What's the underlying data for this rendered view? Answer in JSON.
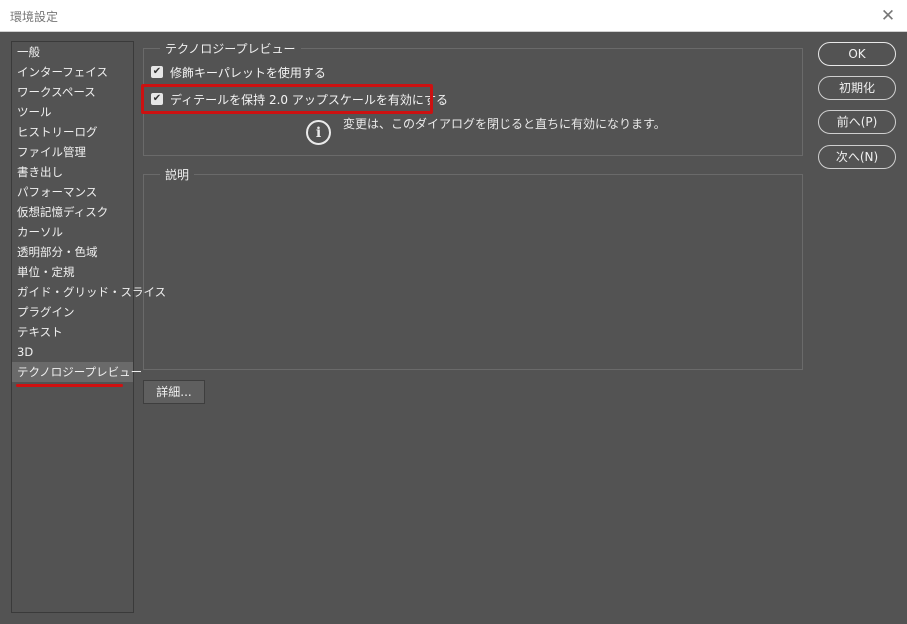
{
  "window": {
    "title": "環境設定",
    "close_glyph": "✕"
  },
  "sidebar": {
    "items": [
      {
        "label": "一般"
      },
      {
        "label": "インターフェイス"
      },
      {
        "label": "ワークスペース"
      },
      {
        "label": "ツール"
      },
      {
        "label": "ヒストリーログ"
      },
      {
        "label": "ファイル管理"
      },
      {
        "label": "書き出し"
      },
      {
        "label": "パフォーマンス"
      },
      {
        "label": "仮想記憶ディスク"
      },
      {
        "label": "カーソル"
      },
      {
        "label": "透明部分・色域"
      },
      {
        "label": "単位・定規"
      },
      {
        "label": "ガイド・グリッド・スライス"
      },
      {
        "label": "プラグイン"
      },
      {
        "label": "テキスト"
      },
      {
        "label": "3D"
      },
      {
        "label": "テクノロジープレビュー",
        "selected": true
      }
    ]
  },
  "tech_preview": {
    "legend": "テクノロジープレビュー",
    "option1": {
      "label": "修飾キーパレットを使用する",
      "checked": true
    },
    "option2": {
      "label": "ディテールを保持 2.0 アップスケールを有効にする",
      "checked": true
    },
    "info_glyph": "i",
    "info_text": "変更は、このダイアログを閉じると直ちに有効になります。"
  },
  "description": {
    "legend": "説明"
  },
  "details_button": "詳細...",
  "buttons": {
    "ok": "OK",
    "reset": "初期化",
    "prev": "前へ(P)",
    "next": "次へ(N)"
  },
  "colors": {
    "background": "#535353",
    "highlight_red": "#cc1111"
  },
  "check_glyph": "✔"
}
